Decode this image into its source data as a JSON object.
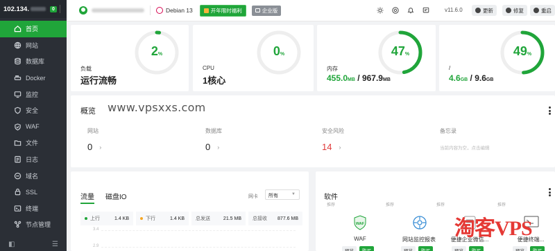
{
  "sidebar": {
    "ip": "102.134.",
    "badge": "0",
    "items": [
      {
        "label": "首页",
        "icon": "home-icon",
        "active": true
      },
      {
        "label": "网站",
        "icon": "globe-icon"
      },
      {
        "label": "数据库",
        "icon": "database-icon"
      },
      {
        "label": "Docker",
        "icon": "docker-icon"
      },
      {
        "label": "监控",
        "icon": "monitor-icon"
      },
      {
        "label": "安全",
        "icon": "shield-icon"
      },
      {
        "label": "WAF",
        "icon": "waf-icon"
      },
      {
        "label": "文件",
        "icon": "folder-icon"
      },
      {
        "label": "日志",
        "icon": "log-icon"
      },
      {
        "label": "域名",
        "icon": "domain-icon"
      },
      {
        "label": "SSL",
        "icon": "ssl-icon"
      },
      {
        "label": "终端",
        "icon": "terminal-icon"
      },
      {
        "label": "节点管理",
        "icon": "node-icon"
      }
    ]
  },
  "header": {
    "os": "Debian 13",
    "promo": "开年限时福利",
    "enterprise": "企业版",
    "version": "v11.6.0",
    "buttons": {
      "update": "更新",
      "repair": "修复",
      "restart": "重启"
    }
  },
  "stats": {
    "load": {
      "label": "负载",
      "value": "运行流畅",
      "percent": "2",
      "percent_value": 2
    },
    "cpu": {
      "label": "CPU",
      "value": "1核心",
      "percent": "0",
      "percent_value": 0
    },
    "memory": {
      "label": "内存",
      "used": "455.0",
      "used_unit": "MB",
      "sep": "/",
      "total": "967.9",
      "total_unit": "MB",
      "percent": "47",
      "percent_value": 47
    },
    "disk": {
      "label": "/",
      "used": "4.6",
      "used_unit": "GB",
      "sep": "/",
      "total": "9.6",
      "total_unit": "GB",
      "percent": "49",
      "percent_value": 49
    },
    "pct_sign": "%"
  },
  "overview": {
    "title": "概览",
    "watermark": "www.vpsxxs.com",
    "sites": {
      "label": "网站",
      "value": "0"
    },
    "databases": {
      "label": "数据库",
      "value": "0"
    },
    "risk": {
      "label": "安全风险",
      "value": "14"
    },
    "memo": {
      "label": "备忘录",
      "text": "当前内容为空，点击编辑"
    }
  },
  "traffic": {
    "tab_flow": "流量",
    "tab_io": "磁盘IO",
    "nic_label": "网卡",
    "nic_value": "所有",
    "up_label": "上行",
    "up_value": "1.4 KB",
    "down_label": "下行",
    "down_value": "1.4 KB",
    "sent_label": "总发送",
    "sent_value": "21.5 MB",
    "recv_label": "总接收",
    "recv_value": "877.6 MB",
    "y_ticks": [
      "3.4",
      "2.9"
    ]
  },
  "software": {
    "title": "软件",
    "items": [
      {
        "tag": "推荐",
        "name": "WAF",
        "preview": "预览",
        "buy": "购买"
      },
      {
        "tag": "推荐",
        "name": "网站监控报表",
        "preview": "预览",
        "buy": "购买"
      },
      {
        "tag": "推荐",
        "name": "便捷企业微信...",
        "preview": "预览",
        "buy": "购买"
      },
      {
        "tag": "推荐",
        "name": "便捷终端...",
        "preview": "预览",
        "buy": "购买"
      }
    ]
  },
  "watermark_vps": "淘客VPS",
  "colors": {
    "accent": "#20a53a",
    "sidebar": "#2b2f36",
    "risk": "#e03a3a"
  }
}
